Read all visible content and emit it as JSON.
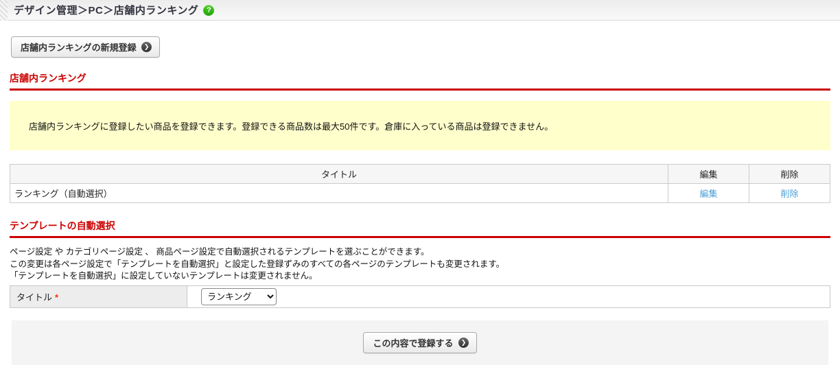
{
  "header": {
    "breadcrumb": "デザイン管理＞PC＞店舗内ランキング",
    "help_icon": "question-mark-circle"
  },
  "actions": {
    "new_button_label": "店舗内ランキングの新規登録",
    "arrow_glyph": "❯",
    "help_glyph": "?"
  },
  "ranking_section": {
    "title": "店舗内ランキング",
    "info_text": "店舗内ランキングに登録したい商品を登録できます。登録できる商品数は最大50件です。倉庫に入っている商品は登録できません。",
    "table": {
      "headers": {
        "title": "タイトル",
        "edit": "編集",
        "delete": "削除"
      },
      "rows": [
        {
          "title": "ランキング（自動選択）",
          "edit_label": "編集",
          "delete_label": "削除"
        }
      ]
    }
  },
  "template_section": {
    "title": "テンプレートの自動選択",
    "description_lines": [
      "ページ設定 や カテゴリページ設定 、 商品ページ設定で自動選択されるテンプレートを選ぶことができます。",
      "この変更は各ページ設定で「テンプレートを自動選択」と設定した登録ずみのすべての各ページのテンプレートも変更されます。",
      "「テンプレートを自動選択」に設定していないテンプレートは変更されません。"
    ],
    "form": {
      "label": "タイトル",
      "required_mark": "*",
      "select_value": "ランキング"
    }
  },
  "footer": {
    "submit_label": "この内容で登録する"
  },
  "colors": {
    "accent_red": "#cc0000",
    "info_bg": "#ffffcc",
    "link_blue": "#4a9fd8",
    "help_green": "#2bb113",
    "label_bg": "#ededed",
    "submit_bar_bg": "#f4f4f4"
  }
}
